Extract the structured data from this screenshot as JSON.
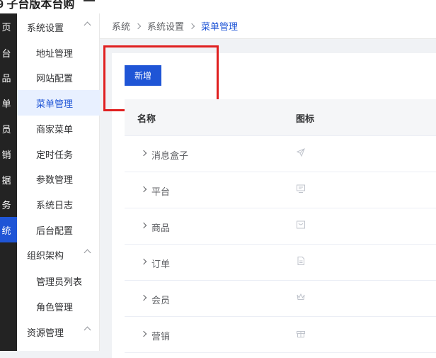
{
  "app": {
    "brand": "9 子台版本台购"
  },
  "rail": {
    "items": [
      {
        "label": "页",
        "active": false
      },
      {
        "label": "台",
        "active": false
      },
      {
        "label": "品",
        "active": false
      },
      {
        "label": "单",
        "active": false
      },
      {
        "label": "员",
        "active": false
      },
      {
        "label": "销",
        "active": false
      },
      {
        "label": "据",
        "active": false
      },
      {
        "label": "务",
        "active": false
      },
      {
        "label": "统",
        "active": true
      }
    ]
  },
  "sidebar": {
    "groups": [
      {
        "label": "系统设置"
      },
      {
        "label": "组织架构"
      },
      {
        "label": "资源管理"
      }
    ],
    "items": [
      {
        "label": "地址管理"
      },
      {
        "label": "网站配置"
      },
      {
        "label": "菜单管理",
        "active": true
      },
      {
        "label": "商家菜单"
      },
      {
        "label": "定时任务"
      },
      {
        "label": "参数管理"
      },
      {
        "label": "系统日志"
      },
      {
        "label": "后台配置"
      },
      {
        "label": "管理员列表"
      },
      {
        "label": "角色管理"
      }
    ]
  },
  "breadcrumb": {
    "items": [
      "系统",
      "系统设置",
      "菜单管理"
    ]
  },
  "toolbar": {
    "add_label": "新增"
  },
  "table": {
    "columns": [
      "名称",
      "图标"
    ],
    "rows": [
      {
        "name": "消息盒子",
        "icon": "send-icon"
      },
      {
        "name": "平台",
        "icon": "monitor-icon"
      },
      {
        "name": "商品",
        "icon": "shopping-box-icon"
      },
      {
        "name": "订单",
        "icon": "document-icon"
      },
      {
        "name": "会员",
        "icon": "crown-icon"
      },
      {
        "name": "营销",
        "icon": "gift-icon"
      }
    ]
  },
  "colors": {
    "accent": "#1f55d6",
    "highlight": "#e02020",
    "rail": "#232323"
  }
}
